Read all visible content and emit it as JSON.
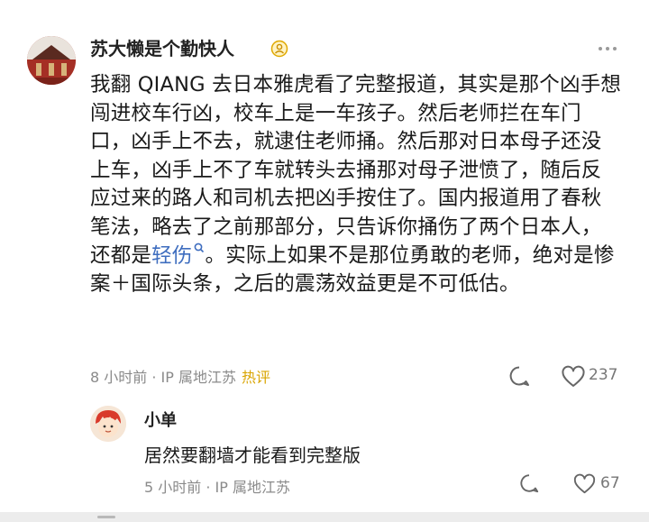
{
  "comment": {
    "username": "苏大懒是个勤快人",
    "text_before_link": "我翻 QIANG 去日本雅虎看了完整报道，其实是那个凶手想闯进校车行凶，校车上是一车孩子。然后老师拦在车门口，凶手上不去，就逮住老师捅。然后那对日本母子还没上车，凶手上不了车就转头去捅那对母子泄愤了，随后反应过来的路人和司机去把凶手按住了。国内报道用了春秋笔法，略去了之前那部分，只告诉你捅伤了两个日本人，还都是",
    "link_text": "轻伤",
    "text_after_link": "。实际上如果不是那位勇敢的老师，绝对是惨案＋国际头条，之后的震荡效益更是不可低估。",
    "meta": "8 小时前 · IP 属地江苏",
    "hot_tag": "热评",
    "like_count": "237"
  },
  "reply": {
    "username": "小单",
    "text": "居然要翻墙才能看到完整版",
    "meta": "5 小时前 · IP 属地江苏",
    "like_count": "67"
  },
  "colors": {
    "link": "#3e6dbf",
    "hot_tag": "#d9a400",
    "meta": "#8a8a8a"
  },
  "icons": [
    "verified-badge-icon",
    "more-icon",
    "reply-icon",
    "heart-icon",
    "search-link-icon"
  ]
}
